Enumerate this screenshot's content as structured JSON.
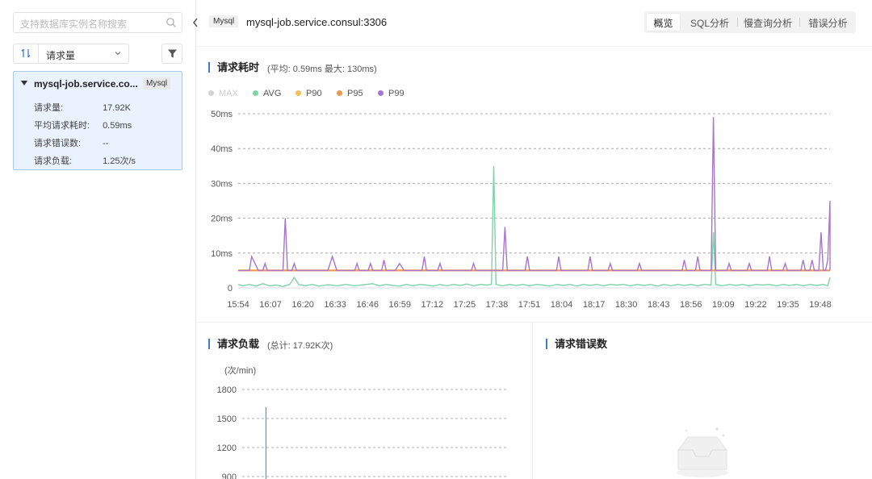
{
  "sidebar": {
    "search_placeholder": "支持数据库实例名称搜索",
    "sort_label": "请求量",
    "instance": {
      "name": "mysql-job.service.co...",
      "tag": "Mysql",
      "stats": [
        {
          "label": "请求量:",
          "value": "17.92K"
        },
        {
          "label": "平均请求耗时:",
          "value": "0.59ms"
        },
        {
          "label": "请求错误数:",
          "value": "--"
        },
        {
          "label": "请求负载:",
          "value": "1.25次/s"
        }
      ]
    }
  },
  "header": {
    "tag": "Mysql",
    "title": "mysql-job.service.consul:3306",
    "tabs": [
      "概览",
      "SQL分析",
      "慢查询分析",
      "错误分析"
    ],
    "active_tab": 0
  },
  "latency_section": {
    "title": "请求耗时",
    "subtitle": "(平均: 0.59ms   最大: 130ms)"
  },
  "load_section": {
    "title": "请求负载",
    "subtitle": "(总计: 17.92K次)"
  },
  "error_section": {
    "title": "请求错误数"
  },
  "chart_data": [
    {
      "type": "line",
      "legend_placement": "top-left",
      "grid": true,
      "ylim": [
        0,
        50
      ],
      "yticks": [
        "50ms",
        "40ms",
        "30ms",
        "20ms",
        "10ms",
        "0"
      ],
      "ytick_values": [
        50,
        40,
        30,
        20,
        10,
        0
      ],
      "xticks": [
        "15:54",
        "16:07",
        "16:20",
        "16:33",
        "16:46",
        "16:59",
        "17:12",
        "17:25",
        "17:38",
        "17:51",
        "18:04",
        "18:17",
        "18:30",
        "18:43",
        "18:56",
        "19:09",
        "19:22",
        "19:35",
        "19:48"
      ],
      "series": [
        {
          "name": "MAX",
          "color": "#d3d3d3",
          "disabled": true,
          "points": []
        },
        {
          "name": "AVG",
          "color": "#7fd3a8",
          "points": [
            [
              0,
              1.0
            ],
            [
              2,
              0.6
            ],
            [
              5,
              1.0
            ],
            [
              8,
              0.5
            ],
            [
              11,
              1.2
            ],
            [
              14,
              0.6
            ],
            [
              17,
              0.8
            ],
            [
              20,
              0.4
            ],
            [
              23,
              1.0
            ],
            [
              25,
              3.0
            ],
            [
              27,
              1.0
            ],
            [
              30,
              0.6
            ],
            [
              33,
              1.0
            ],
            [
              36,
              0.5
            ],
            [
              40,
              0.9
            ],
            [
              44,
              0.6
            ],
            [
              48,
              1.0
            ],
            [
              52,
              0.6
            ],
            [
              56,
              0.9
            ],
            [
              60,
              1.2
            ],
            [
              63,
              0.6
            ],
            [
              66,
              1.0
            ],
            [
              69,
              0.7
            ],
            [
              72,
              0.5
            ],
            [
              75,
              1.0
            ],
            [
              78,
              0.6
            ],
            [
              81,
              1.0
            ],
            [
              84,
              0.8
            ],
            [
              87,
              0.5
            ],
            [
              90,
              1.0
            ],
            [
              93,
              0.6
            ],
            [
              96,
              1.0
            ],
            [
              99,
              0.7
            ],
            [
              102,
              1.1
            ],
            [
              105,
              0.6
            ],
            [
              108,
              1.0
            ],
            [
              111,
              0.8
            ],
            [
              113,
              1.0
            ],
            [
              114,
              35.0
            ],
            [
              115,
              1.0
            ],
            [
              118,
              0.6
            ],
            [
              121,
              1.0
            ],
            [
              124,
              0.7
            ],
            [
              127,
              1.0
            ],
            [
              130,
              0.6
            ],
            [
              133,
              1.0
            ],
            [
              136,
              0.8
            ],
            [
              139,
              0.5
            ],
            [
              142,
              1.0
            ],
            [
              145,
              0.7
            ],
            [
              148,
              1.0
            ],
            [
              151,
              0.5
            ],
            [
              154,
              1.0
            ],
            [
              157,
              0.7
            ],
            [
              160,
              1.0
            ],
            [
              163,
              0.6
            ],
            [
              166,
              1.0
            ],
            [
              169,
              0.8
            ],
            [
              172,
              1.0
            ],
            [
              175,
              0.6
            ],
            [
              178,
              1.0
            ],
            [
              181,
              0.7
            ],
            [
              184,
              1.0
            ],
            [
              187,
              0.5
            ],
            [
              190,
              1.0
            ],
            [
              193,
              0.6
            ],
            [
              196,
              1.0
            ],
            [
              199,
              0.7
            ],
            [
              202,
              1.0
            ],
            [
              205,
              0.6
            ],
            [
              208,
              1.0
            ],
            [
              211,
              0.8
            ],
            [
              212,
              16.0
            ],
            [
              213,
              1.0
            ],
            [
              216,
              0.6
            ],
            [
              219,
              1.0
            ],
            [
              222,
              0.7
            ],
            [
              225,
              1.0
            ],
            [
              228,
              0.6
            ],
            [
              231,
              1.0
            ],
            [
              234,
              0.8
            ],
            [
              237,
              1.0
            ],
            [
              240,
              0.6
            ],
            [
              243,
              1.0
            ],
            [
              246,
              0.7
            ],
            [
              249,
              1.0
            ],
            [
              252,
              0.6
            ],
            [
              255,
              1.0
            ],
            [
              258,
              0.7
            ],
            [
              261,
              1.0
            ],
            [
              263,
              0.6
            ],
            [
              264,
              3.0
            ]
          ]
        },
        {
          "name": "P90",
          "color": "#f2c15c",
          "points": [
            [
              0,
              5
            ],
            [
              264,
              5
            ]
          ]
        },
        {
          "name": "P95",
          "color": "#ef9750",
          "points": [
            [
              0,
              5
            ],
            [
              264,
              5
            ]
          ]
        },
        {
          "name": "P99",
          "color": "#a774cf",
          "points": [
            [
              0,
              5
            ],
            [
              5,
              5
            ],
            [
              6,
              9
            ],
            [
              9,
              5
            ],
            [
              11,
              5
            ],
            [
              12,
              7
            ],
            [
              13,
              5
            ],
            [
              20,
              5
            ],
            [
              21,
              20
            ],
            [
              22,
              5
            ],
            [
              24,
              5
            ],
            [
              25,
              7
            ],
            [
              26,
              5
            ],
            [
              40,
              5
            ],
            [
              42,
              9
            ],
            [
              44,
              5
            ],
            [
              52,
              5
            ],
            [
              53,
              7
            ],
            [
              54,
              5
            ],
            [
              58,
              5
            ],
            [
              59,
              7
            ],
            [
              60,
              5
            ],
            [
              64,
              5
            ],
            [
              65,
              8
            ],
            [
              66,
              5
            ],
            [
              70,
              5
            ],
            [
              72,
              7
            ],
            [
              74,
              5
            ],
            [
              82,
              5
            ],
            [
              83,
              9
            ],
            [
              84,
              5
            ],
            [
              89,
              5
            ],
            [
              90,
              7
            ],
            [
              91,
              5
            ],
            [
              104,
              5
            ],
            [
              105,
              7
            ],
            [
              106,
              5
            ],
            [
              115,
              5
            ],
            [
              118,
              5
            ],
            [
              119,
              17.5
            ],
            [
              120,
              5
            ],
            [
              128,
              5
            ],
            [
              129,
              9
            ],
            [
              130,
              5
            ],
            [
              142,
              5
            ],
            [
              143,
              9
            ],
            [
              144,
              5
            ],
            [
              156,
              5
            ],
            [
              157,
              9
            ],
            [
              158,
              5
            ],
            [
              165,
              5
            ],
            [
              166,
              7
            ],
            [
              167,
              5
            ],
            [
              178,
              5
            ],
            [
              179,
              7
            ],
            [
              180,
              5
            ],
            [
              198,
              5
            ],
            [
              199,
              8
            ],
            [
              200,
              5
            ],
            [
              204,
              5
            ],
            [
              205,
              9
            ],
            [
              206,
              5
            ],
            [
              211,
              5
            ],
            [
              212,
              49
            ],
            [
              213,
              5
            ],
            [
              218,
              5
            ],
            [
              219,
              7
            ],
            [
              220,
              5
            ],
            [
              227,
              5
            ],
            [
              228,
              7
            ],
            [
              229,
              5
            ],
            [
              236,
              5
            ],
            [
              237,
              9
            ],
            [
              238,
              5
            ],
            [
              243,
              5
            ],
            [
              244,
              7
            ],
            [
              245,
              5
            ],
            [
              251,
              5
            ],
            [
              252,
              8
            ],
            [
              253,
              5
            ],
            [
              255,
              5
            ],
            [
              256,
              8
            ],
            [
              257,
              5
            ],
            [
              259,
              5
            ],
            [
              260,
              16
            ],
            [
              261,
              5
            ],
            [
              262,
              5
            ],
            [
              263,
              8
            ],
            [
              264,
              25
            ],
            [
              264,
              5
            ]
          ]
        }
      ]
    },
    {
      "type": "bar",
      "ylabel": "(次/min)",
      "yticks": [
        "1800",
        "1500",
        "1200",
        "900"
      ],
      "ytick_values": [
        1800,
        1500,
        1200,
        900
      ],
      "ylim": [
        900,
        1800
      ],
      "grid": true,
      "series": [
        {
          "name": "",
          "color": "#5b8fd6",
          "points": [
            [
              0.09,
              1620
            ]
          ]
        }
      ]
    }
  ]
}
